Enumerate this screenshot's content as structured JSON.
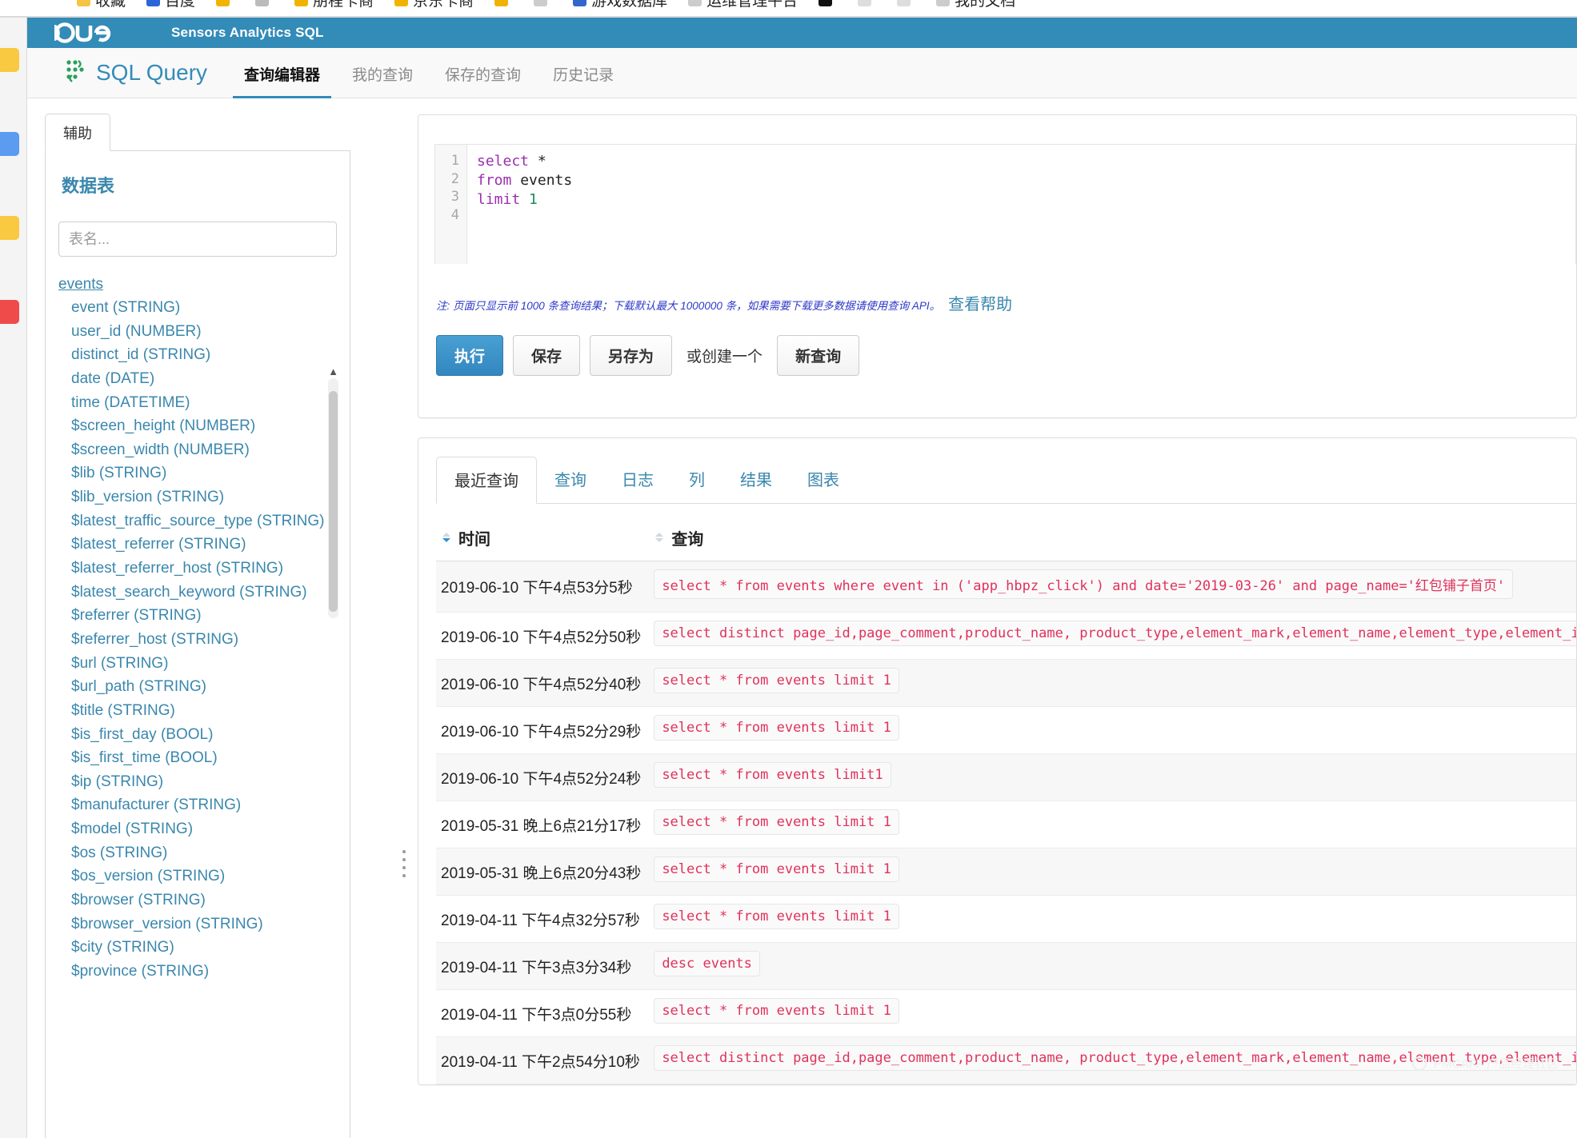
{
  "browser_bookmarks": [
    {
      "label": "收藏",
      "color": "#f6c445"
    },
    {
      "label": "百度",
      "color": "#2a66d9"
    },
    {
      "label": "",
      "color": "#f0b400"
    },
    {
      "label": "",
      "color": "#bbbbbb"
    },
    {
      "label": "朋程卡商",
      "color": "#f0b400"
    },
    {
      "label": "京东卡商",
      "color": "#f0b400"
    },
    {
      "label": "",
      "color": "#f0b400"
    },
    {
      "label": "",
      "color": "#cccccc"
    },
    {
      "label": "游戏数据库",
      "color": "#3366cc"
    },
    {
      "label": "运维管理平台",
      "color": "#cccccc"
    },
    {
      "label": "",
      "color": "#111111"
    },
    {
      "label": "",
      "color": "#dddddd"
    },
    {
      "label": "",
      "color": "#dddddd"
    },
    {
      "label": "我的文档",
      "color": "#cccccc"
    }
  ],
  "rail_icons": [
    {
      "name": "qq-icon",
      "color": "#f8c941"
    },
    {
      "name": "files-icon",
      "color": "#5b9bf0"
    },
    {
      "name": "wifi-icon",
      "color": "#f8c941"
    },
    {
      "name": "media-icon",
      "color": "#ef4b4b"
    }
  ],
  "topbar": {
    "logo_text": "hue",
    "title": "Sensors Analytics SQL"
  },
  "nav": {
    "brand": "SQL Query",
    "items": [
      {
        "label": "查询编辑器",
        "active": true
      },
      {
        "label": "我的查询",
        "active": false
      },
      {
        "label": "保存的查询",
        "active": false
      },
      {
        "label": "历史记录",
        "active": false
      }
    ]
  },
  "assist": {
    "tab_label": "辅助",
    "heading": "数据表",
    "search_placeholder": "表名...",
    "search_value": "",
    "tree_root": "events",
    "fields": [
      "event (STRING)",
      "user_id (NUMBER)",
      "distinct_id (STRING)",
      "date (DATE)",
      "time (DATETIME)",
      "$screen_height (NUMBER)",
      "$screen_width (NUMBER)",
      "$lib (STRING)",
      "$lib_version (STRING)",
      "$latest_traffic_source_type (STRING)",
      "$latest_referrer (STRING)",
      "$latest_referrer_host (STRING)",
      "$latest_search_keyword (STRING)",
      "$referrer (STRING)",
      "$referrer_host (STRING)",
      "$url (STRING)",
      "$url_path (STRING)",
      "$title (STRING)",
      "$is_first_day (BOOL)",
      "$is_first_time (BOOL)",
      "$ip (STRING)",
      "$manufacturer (STRING)",
      "$model (STRING)",
      "$os (STRING)",
      "$os_version (STRING)",
      "$browser (STRING)",
      "$browser_version (STRING)",
      "$city (STRING)",
      "$province (STRING)"
    ]
  },
  "editor": {
    "lines": [
      "1",
      "2",
      "3",
      "4"
    ],
    "code_line1_kw": "select",
    "code_line1_rest": " *",
    "code_line2_kw": "from",
    "code_line2_rest": " events",
    "code_line3_kw": "limit",
    "code_line3_num": "1",
    "note_text": "注: 页面只显示前 1000 条查询结果；下载默认最大 1000000 条，如果需要下载更多数据请使用查询 API。",
    "note_link": "查看帮助",
    "buttons": {
      "execute": "执行",
      "save": "保存",
      "save_as": "另存为",
      "or_create": "或创建一个",
      "new_query": "新查询"
    }
  },
  "results": {
    "tabs": [
      {
        "label": "最近查询",
        "active": true
      },
      {
        "label": "查询",
        "active": false
      },
      {
        "label": "日志",
        "active": false
      },
      {
        "label": "列",
        "active": false
      },
      {
        "label": "结果",
        "active": false
      },
      {
        "label": "图表",
        "active": false
      }
    ],
    "columns": [
      "时间",
      "查询"
    ],
    "rows": [
      {
        "time": "2019-06-10 下午4点53分5秒",
        "query": "select * from events where event in ('app_hbpz_click') and date='2019-03-26' and page_name='红包铺子首页'"
      },
      {
        "time": "2019-06-10 下午4点52分50秒",
        "query": "select distinct page_id,page_comment,product_name, product_type,element_mark,element_name,element_type,element_index from events"
      },
      {
        "time": "2019-06-10 下午4点52分40秒",
        "query": "select * from events limit 1"
      },
      {
        "time": "2019-06-10 下午4点52分29秒",
        "query": "select * from events limit 1"
      },
      {
        "time": "2019-06-10 下午4点52分24秒",
        "query": "select * from events limit1"
      },
      {
        "time": "2019-05-31 晚上6点21分17秒",
        "query": "select * from events limit 1"
      },
      {
        "time": "2019-05-31 晚上6点20分43秒",
        "query": "select * from events limit 1"
      },
      {
        "time": "2019-04-11 下午4点32分57秒",
        "query": "select * from events limit 1"
      },
      {
        "time": "2019-04-11 下午3点3分34秒",
        "query": "desc events"
      },
      {
        "time": "2019-04-11 下午3点0分55秒",
        "query": "select * from events limit 1"
      },
      {
        "time": "2019-04-11 下午2点54分10秒",
        "query": "select distinct page_id,page_comment,product_name, product_type,element_mark,element_name,element_type,element_index from events"
      }
    ]
  },
  "watermark": "PMCAFF 产品经理社区",
  "colors": {
    "topbar": "#338bb8",
    "link": "#3a87ad",
    "primary_button": "#3a92c8",
    "sql_text": "#e0315b",
    "note": "#2d39c9"
  }
}
